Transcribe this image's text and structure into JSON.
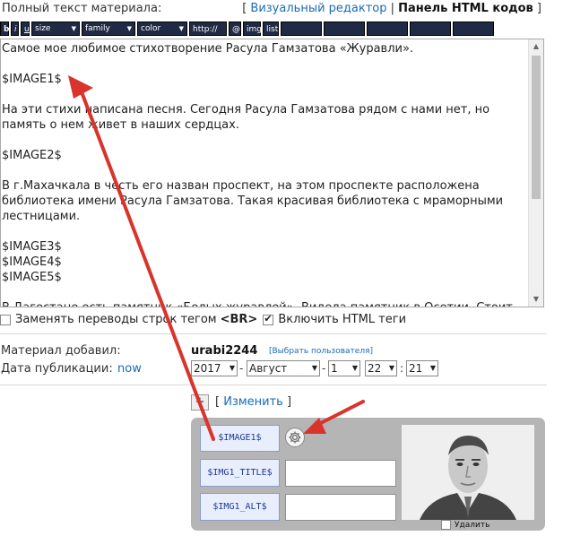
{
  "header": {
    "label": "Полный текст материала:",
    "visual_editor": "Визуальный редактор",
    "html_panel": "Панель HTML кодов"
  },
  "toolbar": {
    "bold": "b",
    "italic": "i",
    "underline": "u",
    "size": "size",
    "family": "family",
    "color": "color",
    "link": "http://",
    "email": "@",
    "img": "img",
    "list": "list"
  },
  "editor": {
    "text": "Самое мое любимое стихотворение Расула Гамзатова «Журавли».\n\n$IMAGE1$\n\nНа эти стихи написана песня. Сегодня Расула Гамзатова рядом с нами нет, но\nпамять о нем живет в наших сердцах.\n\n$IMAGE2$\n\nВ г.Махачкала в честь его назван проспект, на этом проспекте расположена\nбиблиотека имени Расула Гамзатова. Такая красивая библиотека с мраморными\nлестницами.\n\n$IMAGE3$\n$IMAGE4$\n$IMAGE5$\n\nВ Дагестане есть памятник «Белых журавлей». Видела памятник в Осетии. Стоит"
  },
  "options": {
    "replace_breaks": "Заменять переводы строк тегом",
    "br_tag": "<BR>",
    "enable_html": "Включить HTML теги"
  },
  "meta": {
    "added_by_label": "Материал добавил:",
    "username": "urabi2244",
    "choose_user": "[Выбрать пользователя]",
    "pub_date_label": "Дата публикации:",
    "now": "now",
    "year": "2017",
    "month": "Август",
    "day": "1",
    "hour": "22",
    "minute": "21"
  },
  "images": {
    "plus": "+",
    "change_open": "[",
    "change": "Изменить",
    "change_close": "]",
    "image_var": "$IMAGE1$",
    "title_var": "$IMG1_TITLE$",
    "alt_var": "$IMG1_ALT$",
    "delete": "Удалить"
  }
}
